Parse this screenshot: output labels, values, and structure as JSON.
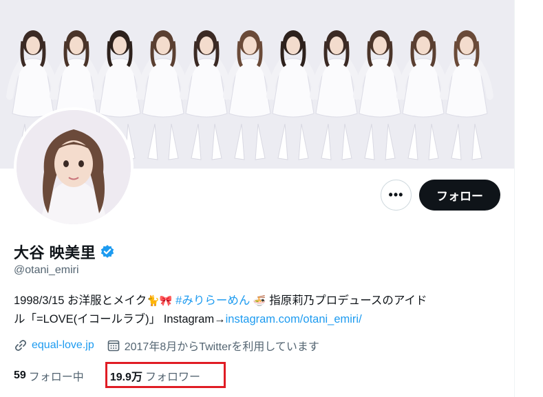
{
  "profile": {
    "display_name": "大谷 映美里",
    "handle": "@otani_emiri",
    "bio_part1": "1998/3/15 お洋服とメイク",
    "bio_hashtag": "#みりらーめん",
    "bio_part2": " 指原莉乃プロデュースのアイド",
    "bio_part3": "ル「=LOVE(イコールラブ)」 Instagram→",
    "bio_link": "instagram.com/otani_emiri/",
    "website": "equal-love.jp",
    "joined": "2017年8月からTwitterを利用しています"
  },
  "actions": {
    "more_label": "•••",
    "follow_label": "フォロー"
  },
  "stats": {
    "following_count": "59",
    "following_label": "フォロー中",
    "followers_count": "19.9万",
    "followers_label": "フォロワー"
  },
  "icons": {
    "emoji_1": "🐈",
    "emoji_2": "🎀",
    "emoji_3": "🍜",
    "verified": "verified-badge-icon",
    "link": "link-icon",
    "calendar": "calendar-icon"
  },
  "colors": {
    "accent": "#1d9bf0",
    "highlight_box": "#e01c24",
    "follow_button": "#0f1419",
    "secondary_text": "#536471"
  }
}
